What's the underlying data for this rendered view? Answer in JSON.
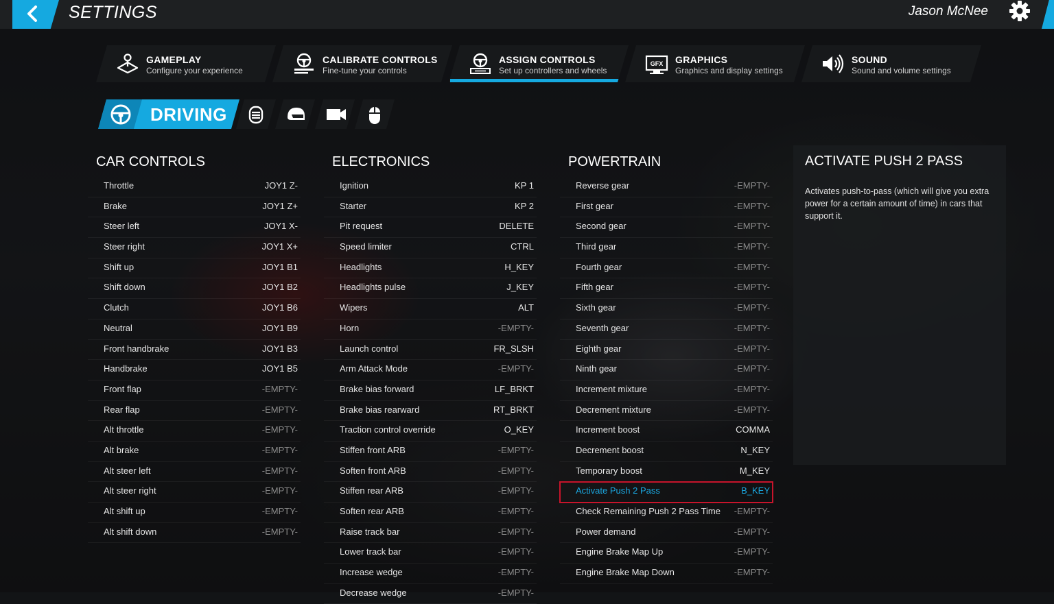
{
  "header": {
    "title": "SETTINGS",
    "username": "Jason McNee"
  },
  "tabs": [
    {
      "label": "GAMEPLAY",
      "sub": "Configure your experience",
      "icon": "joystick-icon",
      "active": false
    },
    {
      "label": "CALIBRATE CONTROLS",
      "sub": "Fine-tune your controls",
      "icon": "steering-wheel-calibrate-icon",
      "active": false
    },
    {
      "label": "ASSIGN CONTROLS",
      "sub": "Set up controllers and wheels",
      "icon": "steering-wheel-assign-icon",
      "active": true
    },
    {
      "label": "GRAPHICS",
      "sub": "Graphics and display settings",
      "icon": "gfx-icon",
      "active": false
    },
    {
      "label": "SOUND",
      "sub": "Sound and volume settings",
      "icon": "speaker-icon",
      "active": false
    }
  ],
  "subtabs": {
    "driving_label": "DRIVING",
    "icons": [
      "driving-wheel-icon",
      "radio-icon",
      "helmet-icon",
      "camera-icon",
      "mouse-icon"
    ]
  },
  "car_controls": {
    "title": "CAR CONTROLS",
    "rows": [
      {
        "label": "Throttle",
        "value": "JOY1 Z-"
      },
      {
        "label": "Brake",
        "value": "JOY1 Z+"
      },
      {
        "label": "Steer left",
        "value": "JOY1 X-"
      },
      {
        "label": "Steer right",
        "value": "JOY1 X+"
      },
      {
        "label": "Shift up",
        "value": "JOY1 B1"
      },
      {
        "label": "Shift down",
        "value": "JOY1 B2"
      },
      {
        "label": "Clutch",
        "value": "JOY1 B6"
      },
      {
        "label": "Neutral",
        "value": "JOY1 B9"
      },
      {
        "label": "Front handbrake",
        "value": "JOY1 B3"
      },
      {
        "label": "Handbrake",
        "value": "JOY1 B5"
      },
      {
        "label": "Front flap",
        "value": "-EMPTY-"
      },
      {
        "label": "Rear flap",
        "value": "-EMPTY-"
      },
      {
        "label": "Alt throttle",
        "value": "-EMPTY-"
      },
      {
        "label": "Alt brake",
        "value": "-EMPTY-"
      },
      {
        "label": "Alt steer left",
        "value": "-EMPTY-"
      },
      {
        "label": "Alt steer right",
        "value": "-EMPTY-"
      },
      {
        "label": "Alt shift up",
        "value": "-EMPTY-"
      },
      {
        "label": "Alt shift down",
        "value": "-EMPTY-"
      }
    ]
  },
  "electronics": {
    "title": "ELECTRONICS",
    "rows": [
      {
        "label": "Ignition",
        "value": "KP 1"
      },
      {
        "label": "Starter",
        "value": "KP 2"
      },
      {
        "label": "Pit request",
        "value": "DELETE"
      },
      {
        "label": "Speed limiter",
        "value": "CTRL"
      },
      {
        "label": "Headlights",
        "value": "H_KEY"
      },
      {
        "label": "Headlights pulse",
        "value": "J_KEY"
      },
      {
        "label": "Wipers",
        "value": "ALT"
      },
      {
        "label": "Horn",
        "value": "-EMPTY-"
      },
      {
        "label": "Launch control",
        "value": "FR_SLSH"
      },
      {
        "label": "Arm Attack Mode",
        "value": "-EMPTY-"
      },
      {
        "label": "Brake bias forward",
        "value": "LF_BRKT"
      },
      {
        "label": "Brake bias rearward",
        "value": "RT_BRKT"
      },
      {
        "label": "Traction control override",
        "value": "O_KEY"
      },
      {
        "label": "Stiffen front ARB",
        "value": "-EMPTY-"
      },
      {
        "label": "Soften front ARB",
        "value": "-EMPTY-"
      },
      {
        "label": "Stiffen rear ARB",
        "value": "-EMPTY-"
      },
      {
        "label": "Soften rear ARB",
        "value": "-EMPTY-"
      },
      {
        "label": "Raise track bar",
        "value": "-EMPTY-"
      },
      {
        "label": "Lower track bar",
        "value": "-EMPTY-"
      },
      {
        "label": "Increase wedge",
        "value": "-EMPTY-"
      },
      {
        "label": "Decrease wedge",
        "value": "-EMPTY-"
      }
    ]
  },
  "powertrain": {
    "title": "POWERTRAIN",
    "rows": [
      {
        "label": "Reverse gear",
        "value": "-EMPTY-"
      },
      {
        "label": "First gear",
        "value": "-EMPTY-"
      },
      {
        "label": "Second gear",
        "value": "-EMPTY-"
      },
      {
        "label": "Third gear",
        "value": "-EMPTY-"
      },
      {
        "label": "Fourth gear",
        "value": "-EMPTY-"
      },
      {
        "label": "Fifth gear",
        "value": "-EMPTY-"
      },
      {
        "label": "Sixth gear",
        "value": "-EMPTY-"
      },
      {
        "label": "Seventh gear",
        "value": "-EMPTY-"
      },
      {
        "label": "Eighth gear",
        "value": "-EMPTY-"
      },
      {
        "label": "Ninth gear",
        "value": "-EMPTY-"
      },
      {
        "label": "Increment mixture",
        "value": "-EMPTY-"
      },
      {
        "label": "Decrement mixture",
        "value": "-EMPTY-"
      },
      {
        "label": "Increment boost",
        "value": "COMMA"
      },
      {
        "label": "Decrement boost",
        "value": "N_KEY"
      },
      {
        "label": "Temporary boost",
        "value": "M_KEY"
      },
      {
        "label": "Activate Push 2 Pass",
        "value": "B_KEY",
        "selected": true
      },
      {
        "label": "Check Remaining Push 2 Pass Time",
        "value": "-EMPTY-"
      },
      {
        "label": "Power demand",
        "value": "-EMPTY-"
      },
      {
        "label": "Engine Brake Map Up",
        "value": "-EMPTY-"
      },
      {
        "label": "Engine Brake Map Down",
        "value": "-EMPTY-"
      }
    ]
  },
  "info": {
    "title": "ACTIVATE PUSH 2 PASS",
    "description": "Activates push-to-pass (which will give you extra power for a certain amount of time) in cars that support it."
  },
  "colors": {
    "accent": "#15a9e0",
    "selection_border": "#c8142b",
    "empty_value": "#8a8a8a"
  }
}
